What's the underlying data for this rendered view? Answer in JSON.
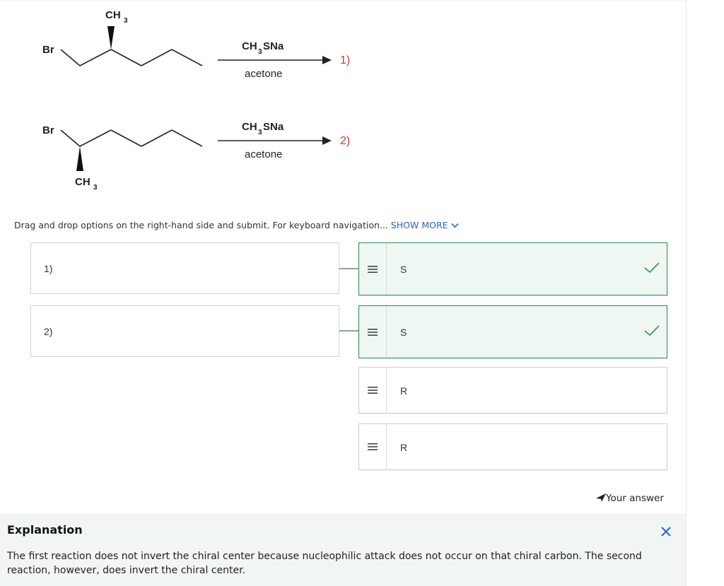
{
  "reactions": {
    "r1": {
      "br": "Br",
      "ch": "CH",
      "sub": "3",
      "reagent_main": "CH",
      "reagent_sub": "3",
      "reagent_rest": "SNa",
      "solvent": "acetone",
      "number": "1)"
    },
    "r2": {
      "br": "Br",
      "ch": "CH",
      "sub": "3",
      "reagent_main": "CH",
      "reagent_sub": "3",
      "reagent_rest": "SNa",
      "solvent": "acetone",
      "number": "2)"
    }
  },
  "instructions": {
    "text": "Drag and drop options on the right-hand side and submit. For keyboard navigation...",
    "show_more": "SHOW MORE"
  },
  "prompts": [
    "1)",
    "2)"
  ],
  "options": [
    {
      "label": "S",
      "status": "correct"
    },
    {
      "label": "S",
      "status": "correct"
    },
    {
      "label": "R",
      "status": "none"
    },
    {
      "label": "R",
      "status": "none"
    }
  ],
  "your_answer": "Your answer",
  "explanation": {
    "title": "Explanation",
    "text": "The first reaction does not invert the chiral center because nucleophilic attack does not occur on that chiral carbon. The second reaction, however, does invert the chiral center."
  },
  "icons": {
    "handle": "drag-handle-icon",
    "check": "checkmark-icon",
    "close": "close-icon",
    "pointer": "send-arrow-icon",
    "chevron": "chevron-down-icon"
  },
  "colors": {
    "correct_border": "#2e8b57",
    "correct_bg": "#eef7f1",
    "check": "#3a9d5d",
    "link": "#2864c8",
    "reaction_number": "#d03a2b",
    "close": "#2864c8",
    "explanation_bg": "#f1f6f4"
  }
}
